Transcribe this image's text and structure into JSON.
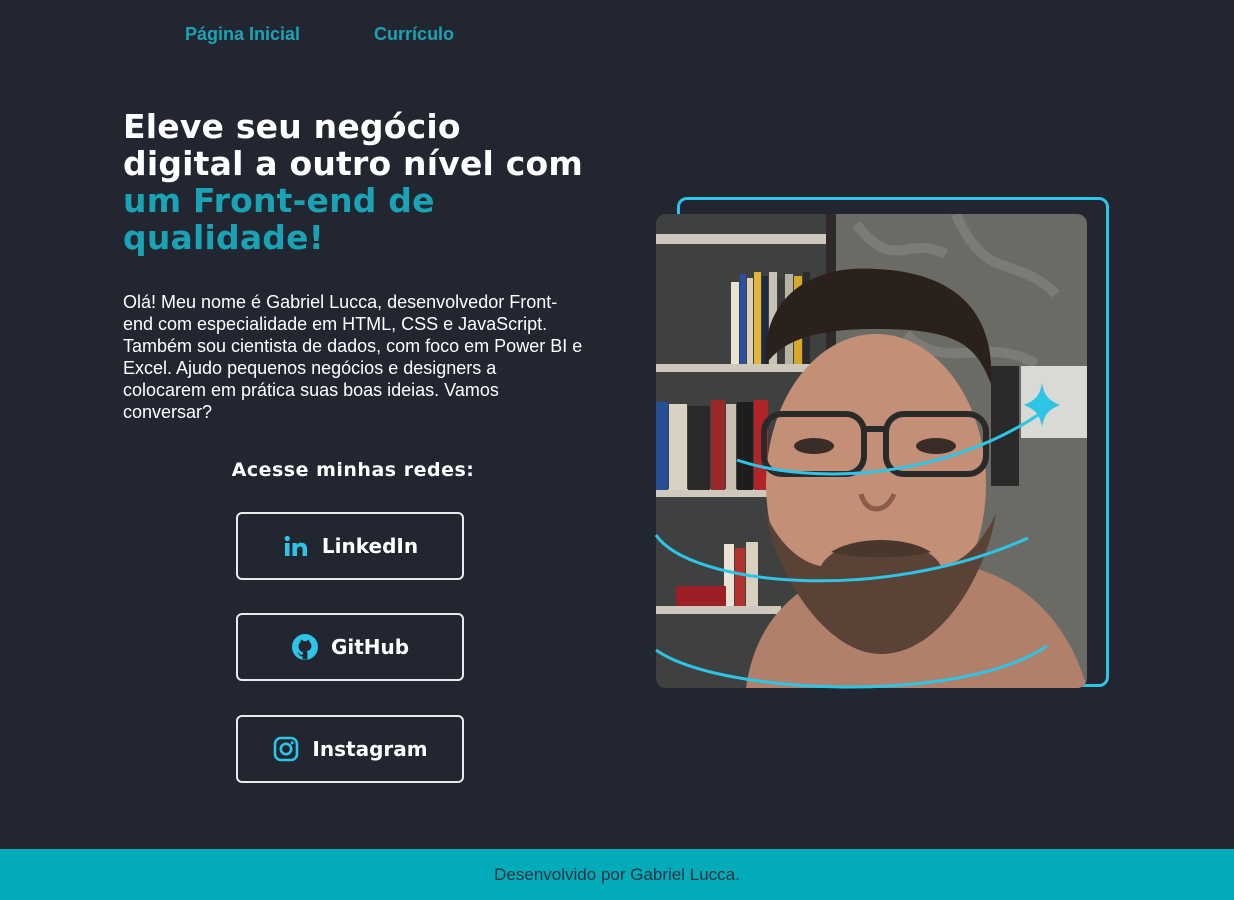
{
  "nav": {
    "home": "Página Inicial",
    "resume": "Currículo"
  },
  "hero": {
    "headline_plain": "Eleve seu negócio digital a outro nível com ",
    "headline_accent": "um Front-end de qualidade!",
    "intro": "Olá! Meu nome é Gabriel Lucca, desenvolvedor Front-end com especialidade em HTML, CSS e JavaScript. Também sou cientista de dados, com foco em Power BI e Excel. Ajudo pequenos negócios e designers a colocarem em prática suas boas ideias. Vamos conversar?"
  },
  "social": {
    "title": "Acesse minhas redes:",
    "linkedin": "LinkedIn",
    "github": "GitHub",
    "instagram": "Instagram"
  },
  "footer": {
    "text": "Desenvolvido por Gabriel Lucca."
  },
  "colors": {
    "background": "#212631",
    "accent": "#1aa3b4",
    "frame": "#2ec4e6",
    "footer": "#01abb9"
  }
}
